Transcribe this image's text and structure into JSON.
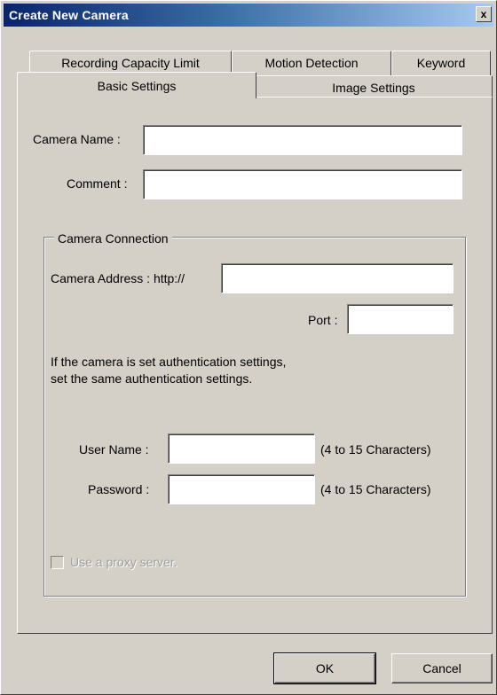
{
  "window": {
    "title": "Create New Camera",
    "close_label": "x"
  },
  "tabs": {
    "back_row": [
      "Recording Capacity Limit",
      "Motion Detection",
      "Keyword"
    ],
    "front_row": [
      "Basic Settings",
      "Image Settings"
    ],
    "selected": "Basic Settings"
  },
  "form": {
    "camera_name_label": "Camera Name :",
    "camera_name_value": "",
    "comment_label": "Comment :",
    "comment_value": "",
    "connection": {
      "group_label": "Camera Connection",
      "address_label": "Camera Address : http://",
      "address_value": "",
      "port_label": "Port :",
      "port_value": "",
      "info_line1": "If the camera is set authentication settings,",
      "info_line2": "set the same authentication settings.",
      "user_name_label": "User Name :",
      "user_name_value": "",
      "user_name_hint": "(4 to 15 Characters)",
      "password_label": "Password :",
      "password_value": "",
      "password_hint": "(4 to 15 Characters)",
      "proxy_label": "Use a proxy server.",
      "proxy_checked": false,
      "proxy_enabled": false
    }
  },
  "buttons": {
    "ok_label": "OK",
    "cancel_label": "Cancel"
  },
  "colors": {
    "title_gradient_start": "#0a246a",
    "title_gradient_end": "#a6caf0",
    "face": "#d4d0c8"
  }
}
